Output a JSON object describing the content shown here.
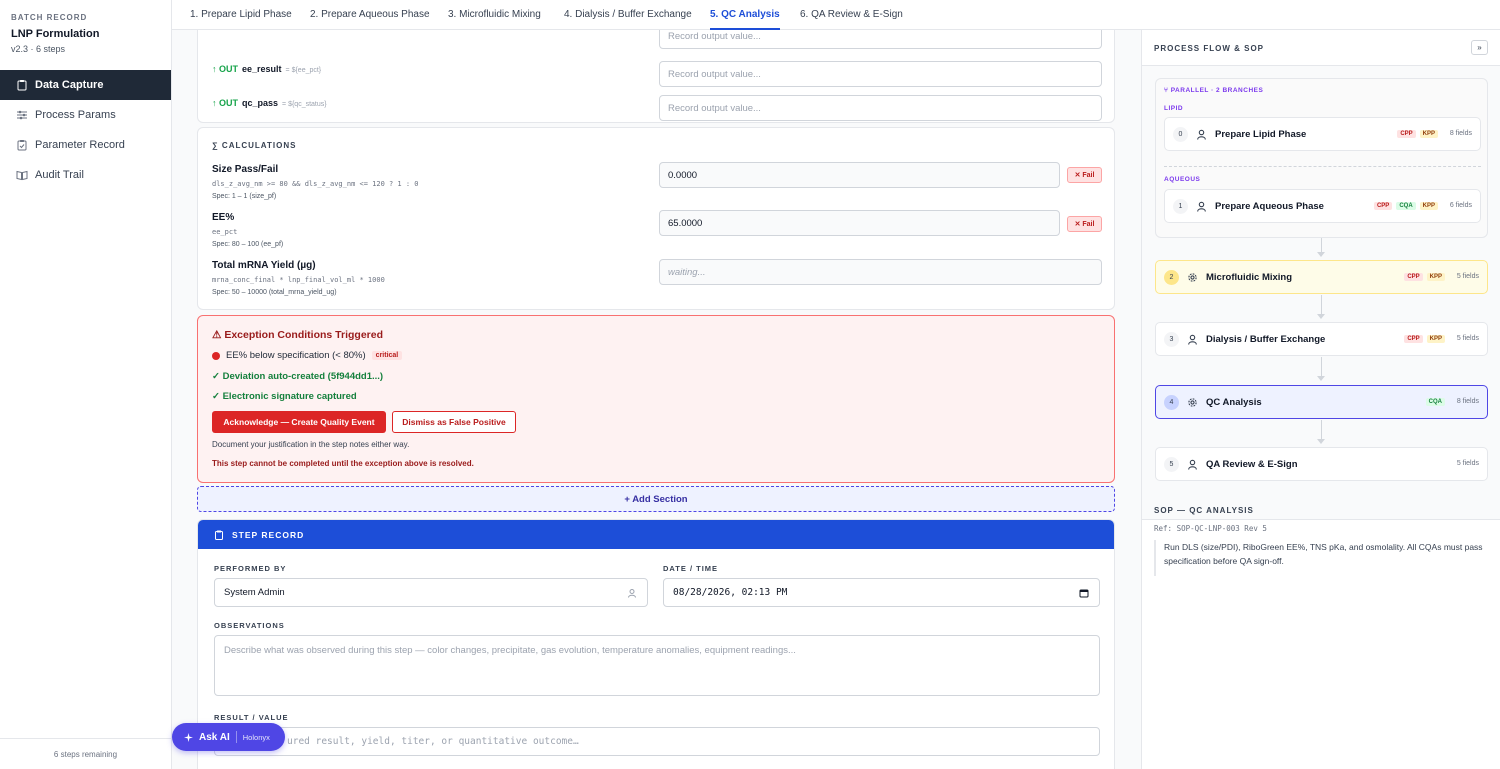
{
  "sidebar": {
    "eyebrow": "BATCH RECORD",
    "title": "LNP Formulation",
    "version": "v2.3 · 6 steps",
    "items": [
      {
        "label": "Data Capture"
      },
      {
        "label": "Process Params"
      },
      {
        "label": "Parameter Record"
      },
      {
        "label": "Audit Trail"
      }
    ],
    "footer": "6 steps remaining"
  },
  "tabs": [
    {
      "label": "1. Prepare Lipid Phase"
    },
    {
      "label": "2. Prepare Aqueous Phase"
    },
    {
      "label": "3. Microfluidic Mixing"
    },
    {
      "label": "4. Dialysis / Buffer Exchange"
    },
    {
      "label": "5. QC Analysis"
    },
    {
      "label": "6. QA Review & E-Sign"
    }
  ],
  "outputs": {
    "placeholder": "Record output value...",
    "rows": [
      {
        "tag": "↑ OUT",
        "name": "ee_result",
        "template": "= ${ee_pct}"
      },
      {
        "tag": "↑ OUT",
        "name": "qc_pass",
        "template": "= ${qc_status}"
      }
    ]
  },
  "calculations": {
    "header": "∑ CALCULATIONS",
    "items": [
      {
        "name": "Size Pass/Fail",
        "expr": "dls_z_avg_nm >= 80 && dls_z_avg_nm <= 120 ? 1 : 0",
        "spec": "Spec: 1 – 1 (size_pf)",
        "value": "0.0000",
        "badge": "✕ Fail"
      },
      {
        "name": "EE%",
        "expr": "ee_pct",
        "spec": "Spec: 80 – 100 (ee_pf)",
        "value": "65.0000",
        "badge": "✕ Fail"
      },
      {
        "name": "Total mRNA Yield (µg)",
        "expr": "mrna_conc_final * lnp_final_vol_ml * 1000",
        "spec": "Spec: 50 – 10000 (total_mrna_yield_ug)",
        "value": "waiting..."
      }
    ]
  },
  "exception": {
    "title": "⚠ Exception Conditions Triggered",
    "item": "EE% below specification (< 80%)",
    "severity": "critical",
    "deviation": "✓ Deviation auto-created (5f944dd1...)",
    "signature": "✓ Electronic signature captured",
    "ack_button": "Acknowledge — Create Quality Event",
    "dismiss_button": "Dismiss as False Positive",
    "note": "Document your justification in the step notes either way.",
    "warning": "This step cannot be completed until the exception above is resolved."
  },
  "add_section": "+ Add Section",
  "step_record": {
    "header": "STEP RECORD",
    "performed_by_label": "PERFORMED BY",
    "performed_by": "System Admin",
    "datetime_label": "DATE / TIME",
    "datetime": "08/28/2026, 02:13 PM",
    "observations_label": "OBSERVATIONS",
    "observations_placeholder": "Describe what was observed during this step — color changes, precipitate, gas evolution, temperature anomalies, equipment readings...",
    "result_label": "RESULT / VALUE",
    "result_placeholder": "ured result, yield, titer, or quantitative outcome…"
  },
  "ask_ai": {
    "label": "Ask AI",
    "sub": "Holonyx"
  },
  "right_panel": {
    "header": "PROCESS FLOW & SOP",
    "collapse": "»",
    "parallel_label": "⑂ PARALLEL · 2 BRANCHES",
    "branch_lipid": "LIPID",
    "branch_aqueous": "AQUEOUS",
    "nodes": [
      {
        "num": "0",
        "name": "Prepare Lipid Phase",
        "tags": [
          "CPP",
          "KPP"
        ],
        "fields": "8 fields"
      },
      {
        "num": "1",
        "name": "Prepare Aqueous Phase",
        "tags": [
          "CPP",
          "CQA",
          "KPP"
        ],
        "fields": "6 fields"
      },
      {
        "num": "2",
        "name": "Microfluidic Mixing",
        "tags": [
          "CPP",
          "KPP"
        ],
        "fields": "5 fields"
      },
      {
        "num": "3",
        "name": "Dialysis / Buffer Exchange",
        "tags": [
          "CPP",
          "KPP"
        ],
        "fields": "5 fields"
      },
      {
        "num": "4",
        "name": "QC Analysis",
        "tags": [
          "CQA"
        ],
        "fields": "8 fields"
      },
      {
        "num": "5",
        "name": "QA Review & E-Sign",
        "tags": [],
        "fields": "5 fields"
      }
    ],
    "sop_header": "SOP — QC ANALYSIS",
    "sop_ref": "Ref: SOP-QC-LNP-003 Rev 5",
    "sop_text": "Run DLS (size/PDI), RiboGreen EE%, TNS pKa, and osmolality. All CQAs must pass specification before QA sign-off."
  }
}
